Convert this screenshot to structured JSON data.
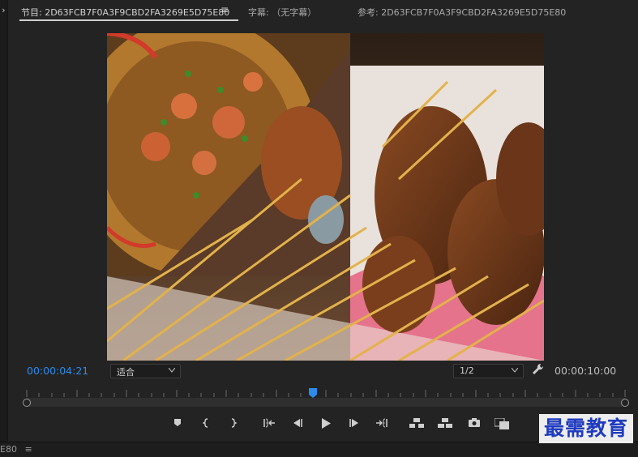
{
  "tabs": {
    "program_label": "节目: 2D63FCB7F0A3F9CBD2FA3269E5D75E80",
    "program_menu": "≡",
    "captions_label": "字幕: （无字幕）",
    "reference_label": "参考: 2D63FCB7F0A3F9CBD2FA3269E5D75E80"
  },
  "viewer": {
    "current_time": "00:00:04:21",
    "fit_label": "适合",
    "resolution_label": "1/2",
    "duration": "00:00:10:00",
    "playhead_position": 0.478
  },
  "icons": {
    "left_panel": "chevron-right-icon",
    "settings": "wrench-icon",
    "transport": [
      "add-marker-icon",
      "mark-in-icon",
      "mark-out-icon",
      "go-to-in-icon",
      "step-back-icon",
      "play-icon",
      "step-forward-icon",
      "go-to-out-icon",
      "lift-icon",
      "extract-icon",
      "export-frame-icon",
      "button-editor-icon"
    ]
  },
  "bottom": {
    "panel_label": "E80",
    "menu": "≡"
  },
  "watermark": "最需教育",
  "colors": {
    "accent": "#2d8ceb",
    "background": "#232323",
    "watermark": "#1f3bbf"
  }
}
